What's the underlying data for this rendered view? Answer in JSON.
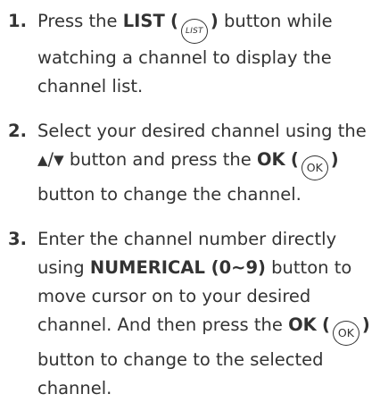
{
  "steps": [
    {
      "number": "1.",
      "text_a": "Press the",
      "button_name": "LIST",
      "paren_open": "(",
      "icon_label": "LIST",
      "paren_close": ")",
      "text_b": "button while watching a channel to display the channel list."
    },
    {
      "number": "2.",
      "text_a": "Select your desired channel using the",
      "up_arrow": "▲",
      "slash": "/",
      "down_arrow": "▼",
      "text_b": "button and press the",
      "button_name": "OK",
      "paren_open": "(",
      "icon_label": "OK",
      "paren_close": ")",
      "text_c": "button to change the channel."
    },
    {
      "number": "3.",
      "text_a": "Enter the channel number directly using",
      "button_name": "NUMERICAL (0~9)",
      "text_b": "button to move cursor on to your desired channel. And then press the",
      "button_name_2": "OK",
      "paren_open": "(",
      "icon_label": "OK",
      "paren_close": ")",
      "text_c": "button to change to the selected channel."
    }
  ]
}
